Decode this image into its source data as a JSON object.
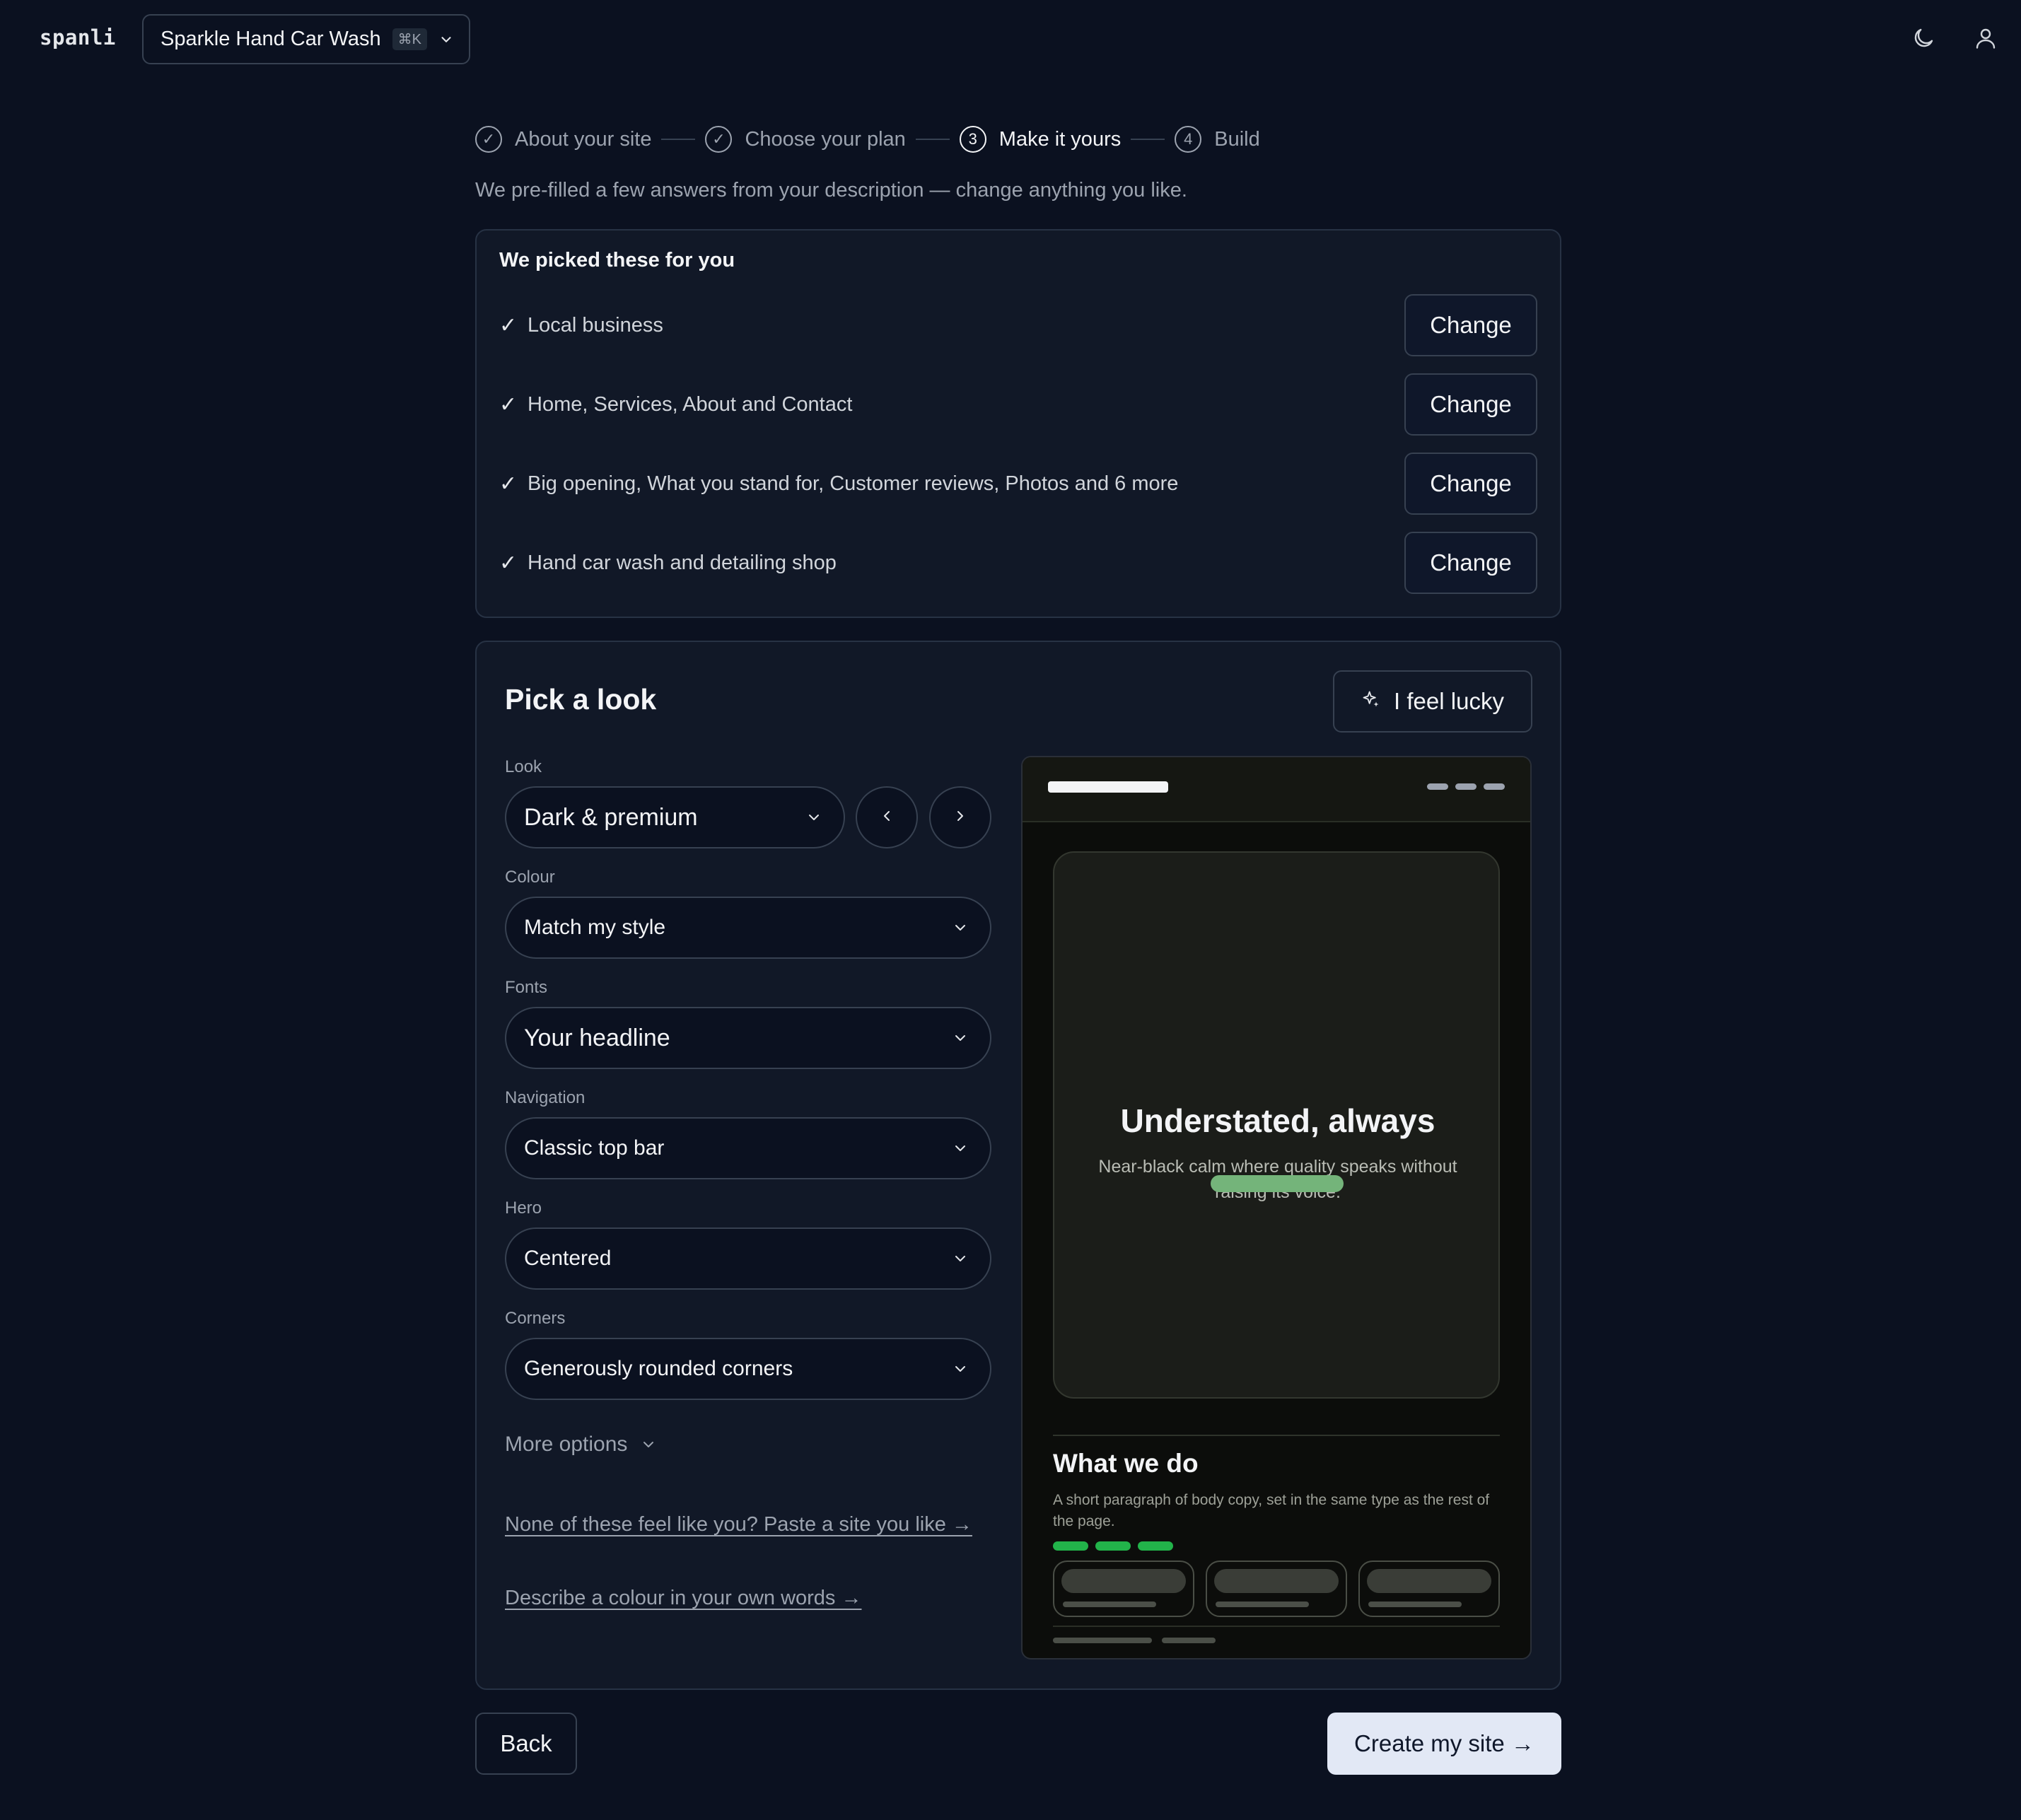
{
  "app": {
    "logo": "spanli",
    "site_name": "Sparkle Hand Car Wash",
    "shortcut": "⌘K"
  },
  "stepper": {
    "steps": [
      {
        "label": "About your site",
        "marker": "✓",
        "state": "done"
      },
      {
        "label": "Choose your plan",
        "marker": "✓",
        "state": "done"
      },
      {
        "label": "Make it yours",
        "marker": "3",
        "state": "current"
      },
      {
        "label": "Build",
        "marker": "4",
        "state": "upcoming"
      }
    ]
  },
  "intro": "We pre-filled a few answers from your description — change anything you like.",
  "picked": {
    "title": "We picked these for you",
    "change_label": "Change",
    "items": [
      "Local business",
      "Home, Services, About and Contact",
      "Big opening, What you stand for, Customer reviews, Photos and 6 more",
      "Hand car wash and detailing shop"
    ]
  },
  "look": {
    "title": "Pick a look",
    "lucky_label": "I feel lucky",
    "fields": {
      "look": {
        "label": "Look",
        "value": "Dark & premium"
      },
      "colour": {
        "label": "Colour",
        "value": "Match my style"
      },
      "fonts": {
        "label": "Fonts",
        "value": "Your headline"
      },
      "navigation": {
        "label": "Navigation",
        "value": "Classic top bar"
      },
      "hero": {
        "label": "Hero",
        "value": "Centered"
      },
      "corners": {
        "label": "Corners",
        "value": "Generously rounded corners"
      }
    },
    "more_options": "More options",
    "paste_link": "None of these feel like you? Paste a site you like →",
    "colour_link": "Describe a colour in your own words →"
  },
  "preview": {
    "hero_title": "Understated, always",
    "hero_text": "Near-black calm where quality speaks without raising its voice.",
    "section_title": "What we do",
    "section_text": "A short paragraph of body copy, set in the same type as the rest of the page.",
    "accent_color": "#22b34a",
    "button_color": "#74b47a"
  },
  "footer": {
    "back_label": "Back",
    "create_label": "Create my site →"
  }
}
